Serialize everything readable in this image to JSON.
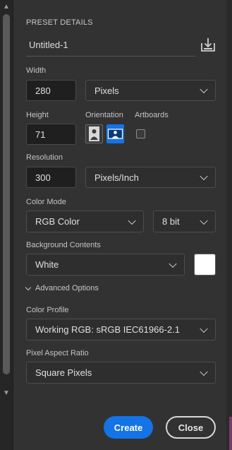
{
  "preset": {
    "section_title": "PRESET DETAILS",
    "name": "Untitled-1",
    "save_icon": "save-preset-icon"
  },
  "width": {
    "label": "Width",
    "value": "280",
    "unit": "Pixels"
  },
  "height": {
    "label": "Height",
    "value": "71"
  },
  "orientation": {
    "label": "Orientation",
    "selected": "landscape",
    "portrait_icon": "portrait-orientation-icon",
    "landscape_icon": "landscape-orientation-icon"
  },
  "artboards": {
    "label": "Artboards",
    "checked": false
  },
  "resolution": {
    "label": "Resolution",
    "value": "300",
    "unit": "Pixels/Inch"
  },
  "color_mode": {
    "label": "Color Mode",
    "mode": "RGB Color",
    "depth": "8 bit"
  },
  "background": {
    "label": "Background Contents",
    "value": "White",
    "swatch_color": "#ffffff"
  },
  "advanced": {
    "label": "Advanced Options"
  },
  "color_profile": {
    "label": "Color Profile",
    "value": "Working RGB: sRGB IEC61966-2.1"
  },
  "pixel_aspect": {
    "label": "Pixel Aspect Ratio",
    "value": "Square Pixels"
  },
  "actions": {
    "create": "Create",
    "close": "Close"
  },
  "colors": {
    "accent": "#1473e6",
    "panel": "#323232"
  }
}
